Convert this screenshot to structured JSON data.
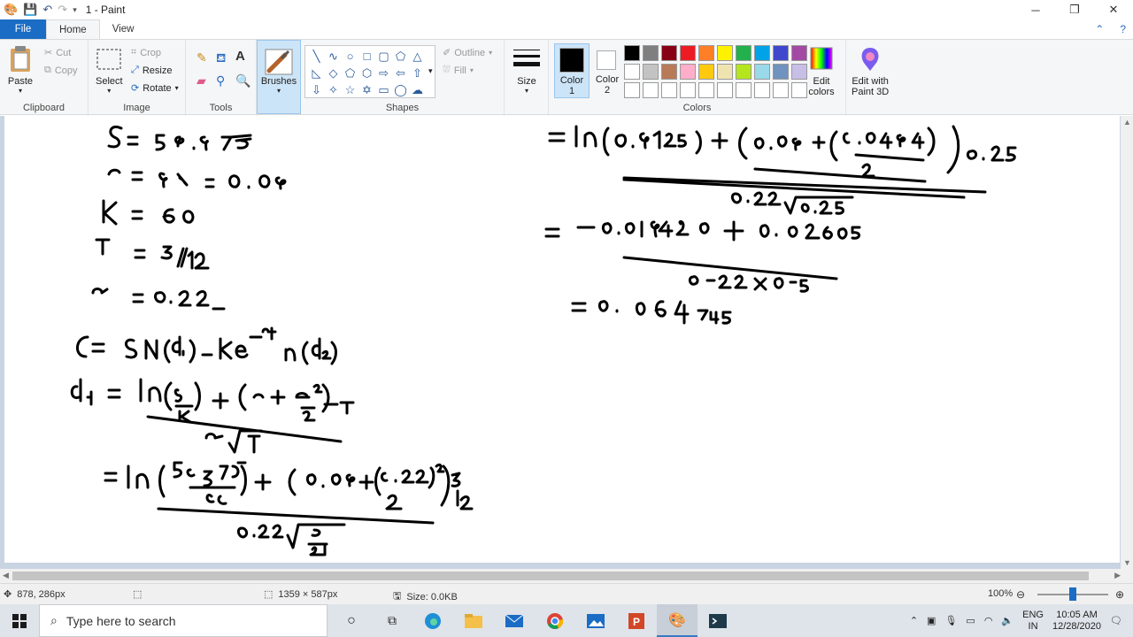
{
  "window": {
    "title": "1 - Paint"
  },
  "tabs": {
    "file": "File",
    "home": "Home",
    "view": "View"
  },
  "clipboard": {
    "paste": "Paste",
    "cut": "Cut",
    "copy": "Copy",
    "label": "Clipboard"
  },
  "image": {
    "select": "Select",
    "crop": "Crop",
    "resize": "Resize",
    "rotate": "Rotate",
    "label": "Image"
  },
  "tools": {
    "label": "Tools"
  },
  "brushes": {
    "label": "Brushes"
  },
  "shapes": {
    "outline": "Outline",
    "fill": "Fill",
    "label": "Shapes"
  },
  "size": {
    "label": "Size"
  },
  "colors": {
    "color1": "Color",
    "color1_num": "1",
    "color2": "Color",
    "color2_num": "2",
    "edit": "Edit",
    "edit2": "colors",
    "paint3d": "Edit with",
    "paint3d2": "Paint 3D",
    "label": "Colors",
    "swatches": [
      "#000000",
      "#7f7f7f",
      "#880015",
      "#ed1c24",
      "#ff7f27",
      "#fff200",
      "#22b14c",
      "#00a2e8",
      "#3f48cc",
      "#a349a4",
      "#ffffff",
      "#c3c3c3",
      "#b97a57",
      "#ffaec9",
      "#ffc90e",
      "#efe4b0",
      "#b5e61d",
      "#99d9ea",
      "#7092be",
      "#c8bfe7",
      "#ffffff",
      "#ffffff",
      "#ffffff",
      "#ffffff",
      "#ffffff",
      "#ffffff",
      "#ffffff",
      "#ffffff",
      "#ffffff",
      "#ffffff"
    ]
  },
  "status": {
    "cursor": "878, 286px",
    "dimensions": "1359 × 587px",
    "size": "Size: 0.0KB",
    "zoom": "100%"
  },
  "taskbar": {
    "search_placeholder": "Type here to search",
    "lang1": "ENG",
    "lang2": "IN",
    "time": "10:05 AM",
    "date": "12/28/2020"
  }
}
